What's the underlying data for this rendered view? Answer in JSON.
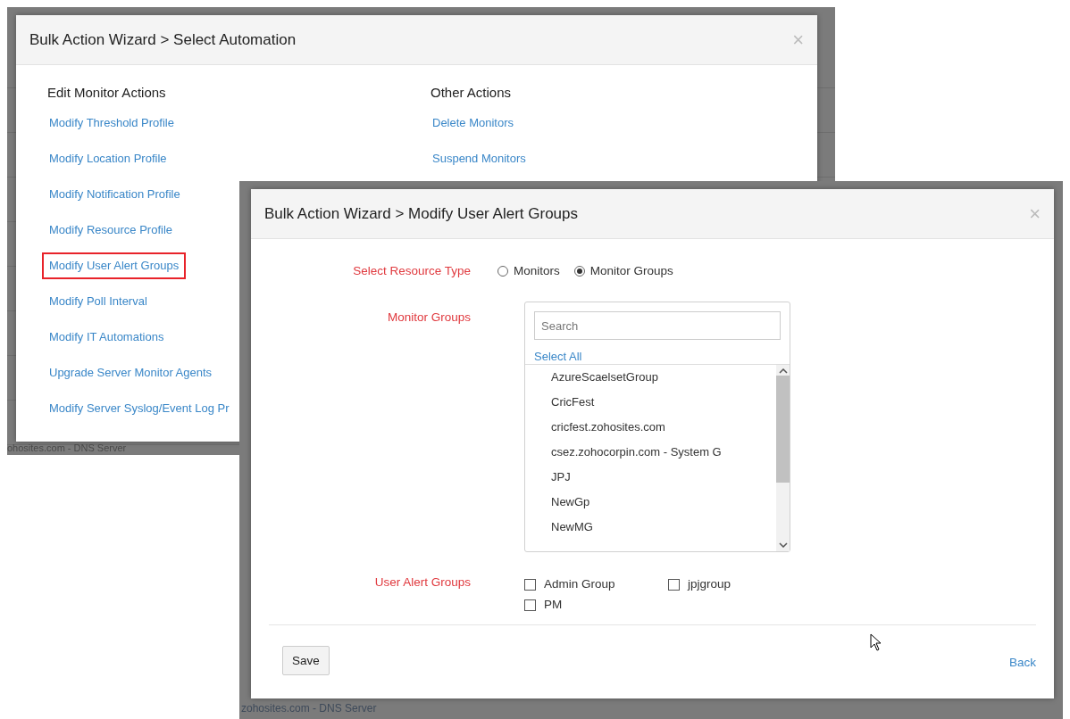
{
  "background_texts": [
    {
      "text": "ohosites.com - DNS Server"
    },
    {
      "text": "zohosites.com - DNS Server"
    }
  ],
  "select_dialog": {
    "title": "Bulk Action Wizard > Select Automation",
    "close": "×",
    "columns": [
      {
        "heading": "Edit Monitor Actions",
        "items": [
          {
            "label": "Modify Threshold Profile",
            "selected": false
          },
          {
            "label": "Modify Location Profile",
            "selected": false
          },
          {
            "label": "Modify Notification Profile",
            "selected": false
          },
          {
            "label": "Modify Resource Profile",
            "selected": false
          },
          {
            "label": "Modify User Alert Groups",
            "selected": true
          },
          {
            "label": "Modify Poll Interval",
            "selected": false
          },
          {
            "label": "Modify IT Automations",
            "selected": false
          },
          {
            "label": "Upgrade Server Monitor Agents",
            "selected": false
          },
          {
            "label": "Modify Server Syslog/Event Log Pr",
            "selected": false
          }
        ]
      },
      {
        "heading": "Other Actions",
        "items": [
          {
            "label": "Delete Monitors",
            "selected": false
          },
          {
            "label": "Suspend Monitors",
            "selected": false
          }
        ]
      }
    ]
  },
  "modify_dialog": {
    "title": "Bulk Action Wizard > Modify User Alert Groups",
    "close": "×",
    "resource_type": {
      "label": "Select Resource Type",
      "options": [
        {
          "label": "Monitors",
          "selected": false
        },
        {
          "label": "Monitor Groups",
          "selected": true
        }
      ]
    },
    "monitor_groups": {
      "label": "Monitor Groups",
      "search": {
        "placeholder": "Search"
      },
      "select_all": "Select All",
      "items": [
        "AzureScaelsetGroup",
        "CricFest",
        "cricfest.zohosites.com",
        "csez.zohocorpin.com - System G",
        "JPJ",
        "NewGp",
        "NewMG"
      ]
    },
    "user_alert_groups": {
      "label": "User Alert Groups",
      "options": [
        {
          "label": "Admin Group",
          "checked": false
        },
        {
          "label": "jpjgroup",
          "checked": false
        },
        {
          "label": "PM",
          "checked": false
        }
      ]
    },
    "buttons": {
      "save": "Save",
      "back": "Back"
    }
  }
}
